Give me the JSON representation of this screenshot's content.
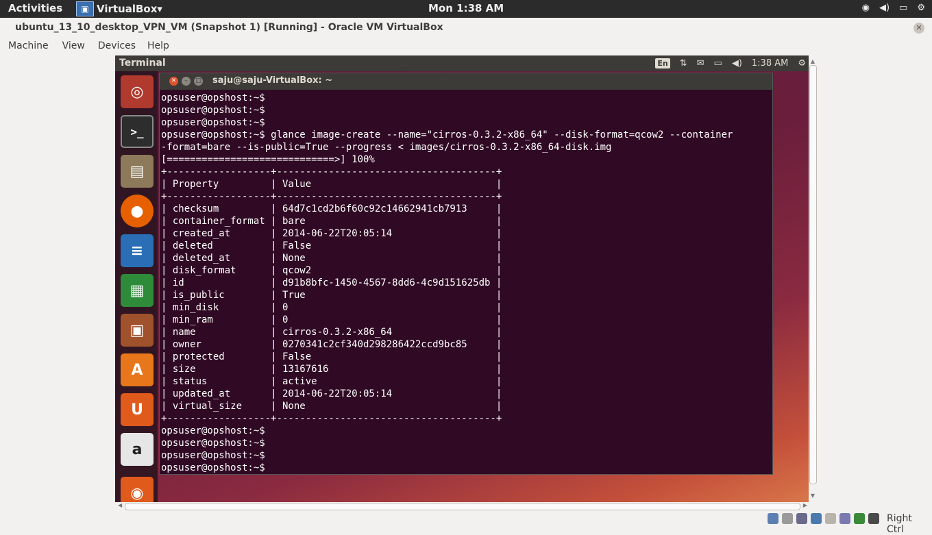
{
  "host_topbar": {
    "activities": "Activities",
    "app_menu": "VirtualBox",
    "app_menu_arrow": "▾",
    "clock": "Mon  1:38 AM",
    "tray": [
      "wifi-icon",
      "volume-icon",
      "battery-icon",
      "settings-icon"
    ]
  },
  "vbox": {
    "title": "ubuntu_13_10_desktop_VPN_VM (Snapshot 1) [Running] - Oracle VM VirtualBox",
    "menu": [
      "Machine",
      "View",
      "Devices",
      "Help"
    ],
    "host_key": "Right Ctrl"
  },
  "guest": {
    "topbar_title": "Terminal",
    "keyboard_layout": "En",
    "time": "1:38 AM",
    "launcher": [
      {
        "name": "dash-home",
        "color": "#c0392b"
      },
      {
        "name": "terminal",
        "color": "#2d2d2d"
      },
      {
        "name": "files",
        "color": "#8c7a5a"
      },
      {
        "name": "firefox",
        "color": "#e66000"
      },
      {
        "name": "libreoffice-writer",
        "color": "#2a6fb5"
      },
      {
        "name": "libreoffice-calc",
        "color": "#2e8b3a"
      },
      {
        "name": "libreoffice-impress",
        "color": "#a0522d"
      },
      {
        "name": "ubuntu-software-center",
        "color": "#e8761a"
      },
      {
        "name": "ubuntu-one",
        "color": "#e05a1c"
      },
      {
        "name": "amazon",
        "color": "#e6e6e6"
      },
      {
        "name": "ubuntu-one-music",
        "color": "#e05a1c"
      }
    ]
  },
  "terminal": {
    "window_title": "saju@saju-VirtualBox: ~",
    "content": "opsuser@opshost:~$\nopsuser@opshost:~$\nopsuser@opshost:~$\nopsuser@opshost:~$ glance image-create --name=\"cirros-0.3.2-x86_64\" --disk-format=qcow2 --container\n-format=bare --is-public=True --progress < images/cirros-0.3.2-x86_64-disk.img\n[=============================>] 100%\n+------------------+--------------------------------------+\n| Property         | Value                                |\n+------------------+--------------------------------------+\n| checksum         | 64d7c1cd2b6f60c92c14662941cb7913     |\n| container_format | bare                                 |\n| created_at       | 2014-06-22T20:05:14                  |\n| deleted          | False                                |\n| deleted_at       | None                                 |\n| disk_format      | qcow2                                |\n| id               | d91b8bfc-1450-4567-8dd6-4c9d151625db |\n| is_public        | True                                 |\n| min_disk         | 0                                    |\n| min_ram          | 0                                    |\n| name             | cirros-0.3.2-x86_64                  |\n| owner            | 0270341c2cf340d298286422ccd9bc85     |\n| protected        | False                                |\n| size             | 13167616                             |\n| status           | active                               |\n| updated_at       | 2014-06-22T20:05:14                  |\n| virtual_size     | None                                 |\n+------------------+--------------------------------------+\nopsuser@opshost:~$\nopsuser@opshost:~$\nopsuser@opshost:~$\nopsuser@opshost:~$"
  },
  "statusbar_icons": [
    {
      "name": "hard-disk-icon",
      "color": "#5b7fb0"
    },
    {
      "name": "optical-drive-icon",
      "color": "#9a9a9a"
    },
    {
      "name": "usb-icon",
      "color": "#6a6a8a"
    },
    {
      "name": "network-icon",
      "color": "#4a7ab0"
    },
    {
      "name": "shared-folders-icon",
      "color": "#b8b4ac"
    },
    {
      "name": "video-capture-icon",
      "color": "#7a7ab0"
    },
    {
      "name": "virtualization-icon",
      "color": "#3a8a3a"
    },
    {
      "name": "mouse-integration-icon",
      "color": "#4a4a4a"
    }
  ]
}
